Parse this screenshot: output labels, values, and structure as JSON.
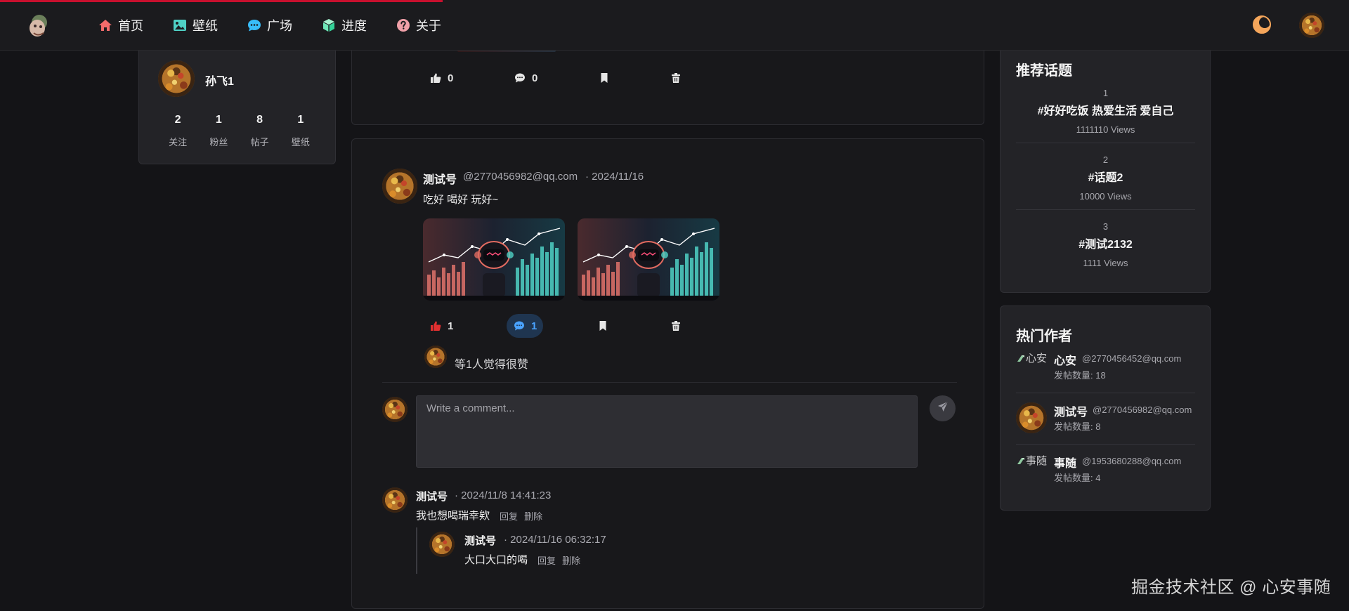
{
  "nav": {
    "items": [
      {
        "label": "首页",
        "icon": "home-icon",
        "color": "#f26b6b"
      },
      {
        "label": "壁纸",
        "icon": "image-icon",
        "color": "#4fd1c5"
      },
      {
        "label": "广场",
        "icon": "chat-icon",
        "color": "#38bdf8"
      },
      {
        "label": "进度",
        "icon": "cube-icon",
        "color": "#6ee7b7"
      },
      {
        "label": "关于",
        "icon": "question-icon",
        "color": "#f0a0a8"
      }
    ],
    "theme_icon": "moon-icon",
    "accent": "#f5a65b"
  },
  "profile": {
    "name": "孙飞1",
    "stats": [
      {
        "value": "2",
        "label": "关注"
      },
      {
        "value": "1",
        "label": "粉丝"
      },
      {
        "value": "8",
        "label": "帖子"
      },
      {
        "value": "1",
        "label": "壁纸"
      }
    ]
  },
  "prev_post": {
    "likes": "0",
    "comments": "0"
  },
  "post": {
    "author": "测试号",
    "email": "@2770456982@qq.com",
    "date": "· 2024/11/16",
    "text": "吃好 喝好 玩好~",
    "likes": "1",
    "comments": "1",
    "liked_by_text": "等1人觉得很赞",
    "comment_placeholder": "Write a comment...",
    "comments_list": [
      {
        "author": "测试号",
        "time": "· 2024/11/8 14:41:23",
        "text": "我也想喝瑞幸欸",
        "reply_label": "回复",
        "delete_label": "删除",
        "replies": [
          {
            "author": "测试号",
            "time": "· 2024/11/16 06:32:17",
            "text": "大口大口的喝",
            "reply_label": "回复",
            "delete_label": "删除"
          }
        ]
      }
    ]
  },
  "topics": {
    "title": "推荐话题",
    "items": [
      {
        "rank": "1",
        "name": "#好好吃饭 热爱生活 爱自己",
        "views": "1111110 Views"
      },
      {
        "rank": "2",
        "name": "#话题2",
        "views": "10000 Views"
      },
      {
        "rank": "3",
        "name": "#测试2132",
        "views": "1111 Views"
      }
    ]
  },
  "authors": {
    "title": "热门作者",
    "items": [
      {
        "name": "心安",
        "email": "@2770456452@qq.com",
        "count": "发帖数量: 18",
        "avatar_alt": "心安"
      },
      {
        "name": "测试号",
        "email": "@2770456982@qq.com",
        "count": "发帖数量: 8",
        "avatar_alt": ""
      },
      {
        "name": "事随",
        "email": "@1953680288@qq.com",
        "count": "发帖数量: 4",
        "avatar_alt": "事随"
      }
    ]
  },
  "watermark": "掘金技术社区 @ 心安事随"
}
